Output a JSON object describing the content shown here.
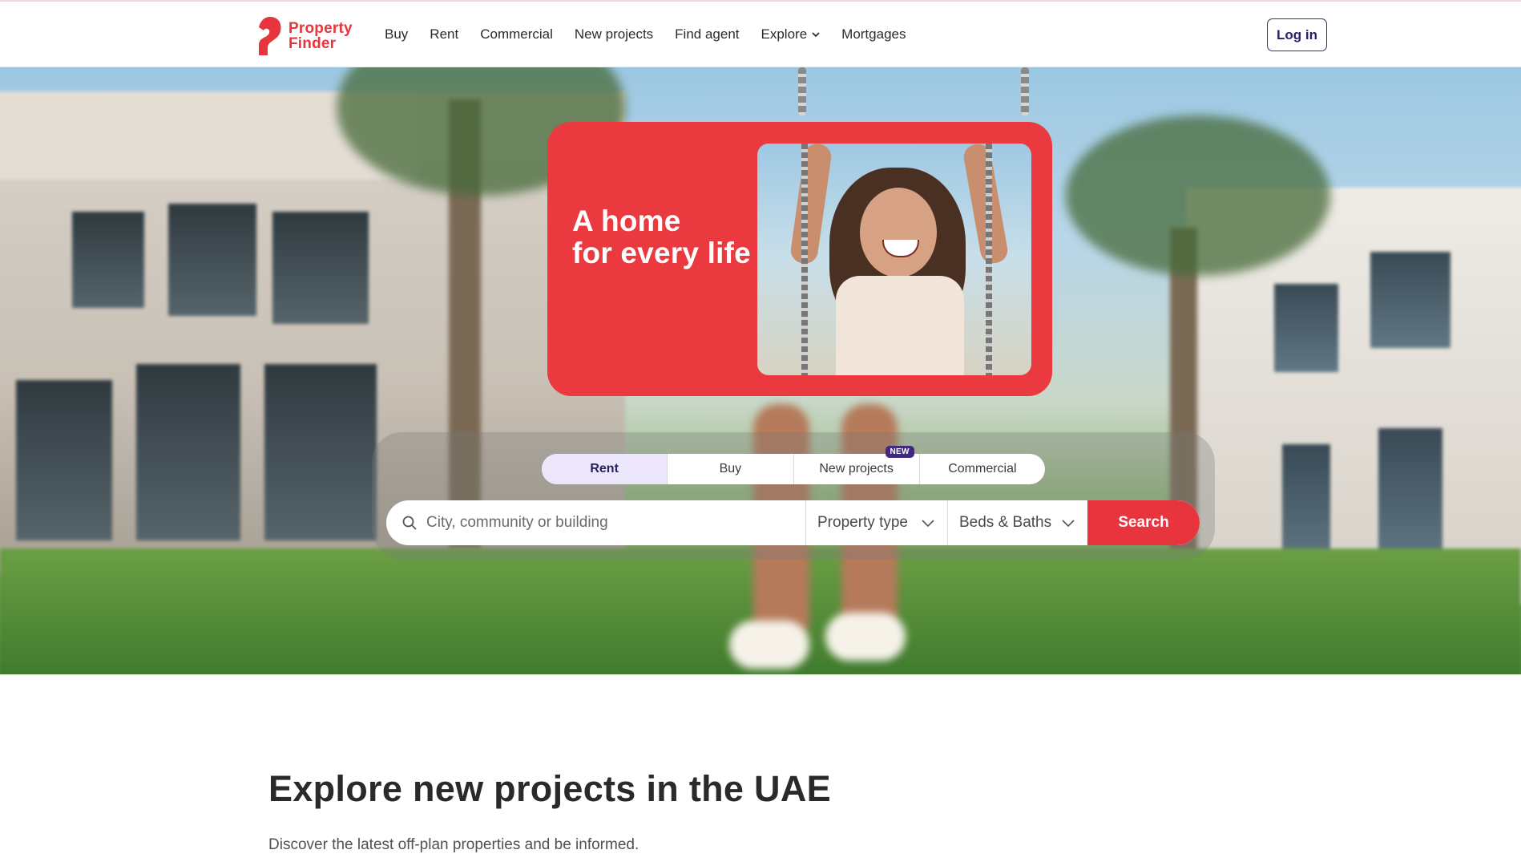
{
  "header": {
    "logo": {
      "line1": "Property",
      "line2": "Finder",
      "icon": "property-finder-logo-icon"
    },
    "nav": [
      "Buy",
      "Rent",
      "Commercial",
      "New projects",
      "Find agent",
      "Explore",
      "Mortgages"
    ],
    "explore_icon": "chevron-down-icon",
    "login_label": "Log in"
  },
  "hero": {
    "promo_line1": "A home",
    "promo_line2": "for every life"
  },
  "search": {
    "tabs": [
      "Rent",
      "Buy",
      "New projects",
      "Commercial"
    ],
    "active_tab": "Rent",
    "new_badge": "NEW",
    "location_placeholder": "City, community or building",
    "property_type": "Property type",
    "beds_baths": "Beds & Baths",
    "button_label": "Search"
  },
  "section": {
    "title": "Explore new projects in the UAE",
    "subtitle": "Discover the latest off-plan properties and be informed."
  },
  "colors": {
    "brand_red": "#e8343d",
    "brand_purple": "#3f2a7e",
    "active_tab_bg": "#ebe6f9"
  }
}
